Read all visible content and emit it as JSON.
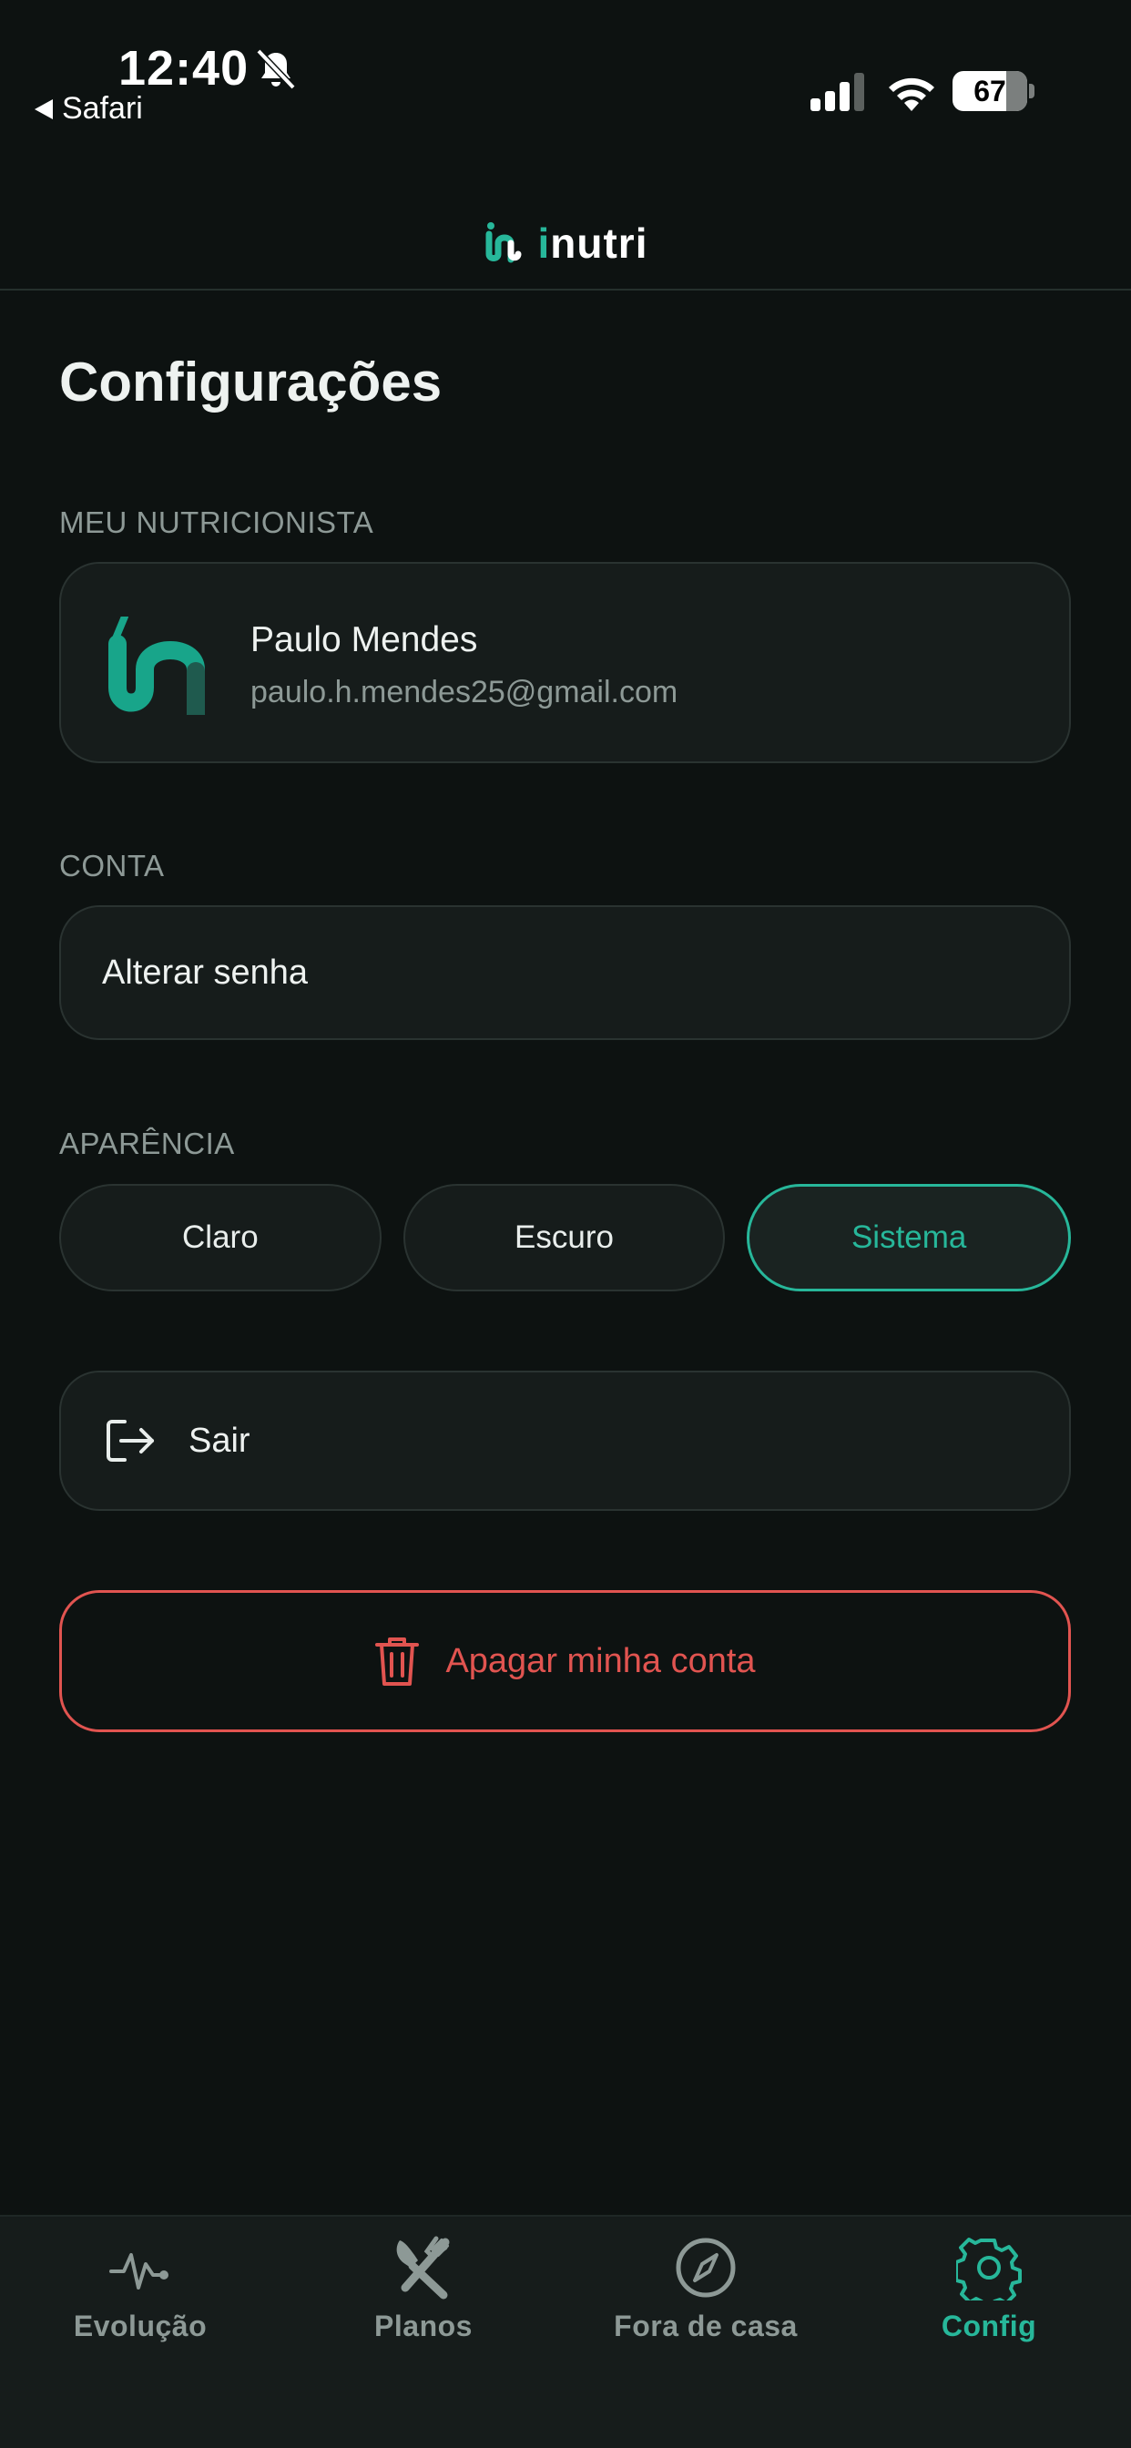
{
  "status_bar": {
    "time": "12:40",
    "back_app": "Safari",
    "battery_percent": "67",
    "icons": [
      "bell-slash-icon",
      "cellular-signal-icon",
      "wifi-icon",
      "battery-icon"
    ]
  },
  "header": {
    "logo_text_accent": "i",
    "logo_text_rest": "nutri"
  },
  "page": {
    "title": "Configurações"
  },
  "nutritionist": {
    "section_label": "MEU NUTRICIONISTA",
    "name": "Paulo Mendes",
    "email": "paulo.h.mendes25@gmail.com"
  },
  "account": {
    "section_label": "CONTA",
    "change_password_label": "Alterar senha"
  },
  "appearance": {
    "section_label": "APARÊNCIA",
    "options": [
      "Claro",
      "Escuro",
      "Sistema"
    ],
    "selected": "Sistema"
  },
  "logout": {
    "label": "Sair"
  },
  "delete_account": {
    "label": "Apagar minha conta"
  },
  "tabbar": {
    "tabs": [
      {
        "label": "Evolução",
        "icon": "activity-icon"
      },
      {
        "label": "Planos",
        "icon": "utensils-icon"
      },
      {
        "label": "Fora de casa",
        "icon": "compass-icon"
      },
      {
        "label": "Config",
        "icon": "gear-icon"
      }
    ],
    "active": "Config"
  },
  "colors": {
    "background": "#0d1211",
    "card": "#161c1b",
    "accent": "#27b79a",
    "danger": "#e15450",
    "muted_text": "#8d9996"
  }
}
